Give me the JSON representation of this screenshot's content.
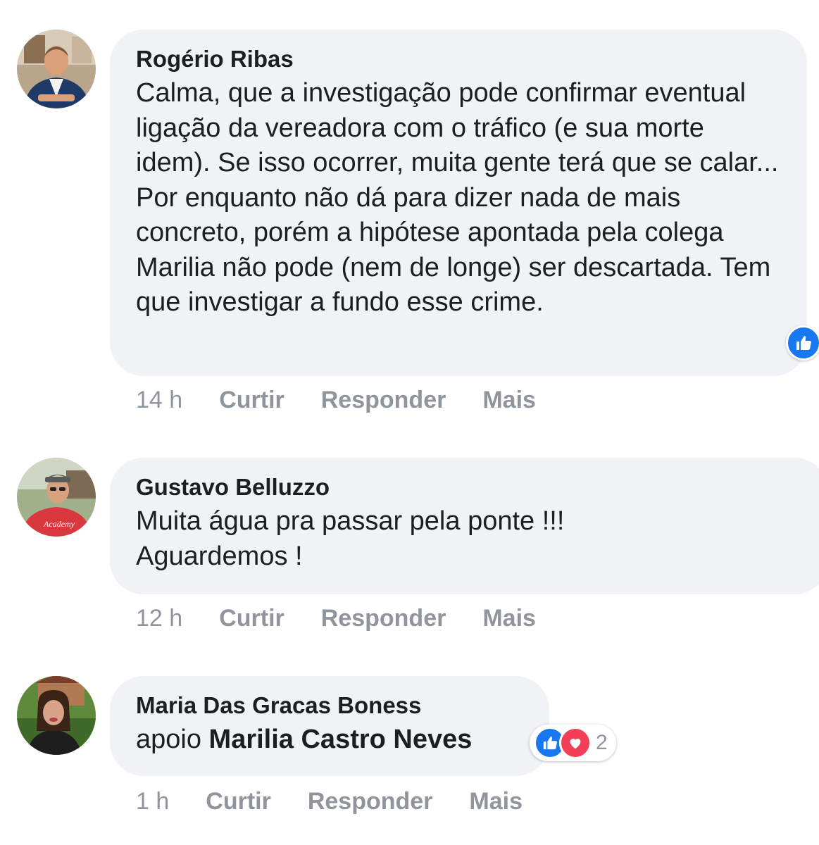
{
  "comments": [
    {
      "author": "Rogério Ribas",
      "text": "Calma, que a investigação pode confirmar eventual ligação da vereadora com o tráfico (e sua morte idem). Se isso ocorrer, muita gente terá que se calar... Por enquanto não dá para dizer nada de mais concreto, porém a hipótese apontada pela colega Marilia não pode (nem de longe) ser descartada. Tem que investigar a fundo esse crime.",
      "time": "14 h",
      "reaction_icon": "like-icon"
    },
    {
      "author": "Gustavo Belluzzo",
      "text": "Muita água pra passar pela ponte !!!\nAguardemos !",
      "time": "12 h"
    },
    {
      "author": "Maria Das Gracas Boness",
      "text_prefix": "apoio",
      "mention": "Marilia Castro Neves",
      "time": "1 h",
      "reaction_icons": [
        "like-icon",
        "love-icon"
      ],
      "reaction_count": "2"
    }
  ],
  "actions": {
    "like": "Curtir",
    "reply": "Responder",
    "more": "Mais"
  },
  "colors": {
    "bubble": "#f0f2f5",
    "like_blue": "#1877f2",
    "love_red": "#f33e58",
    "meta_gray": "#90949c"
  }
}
